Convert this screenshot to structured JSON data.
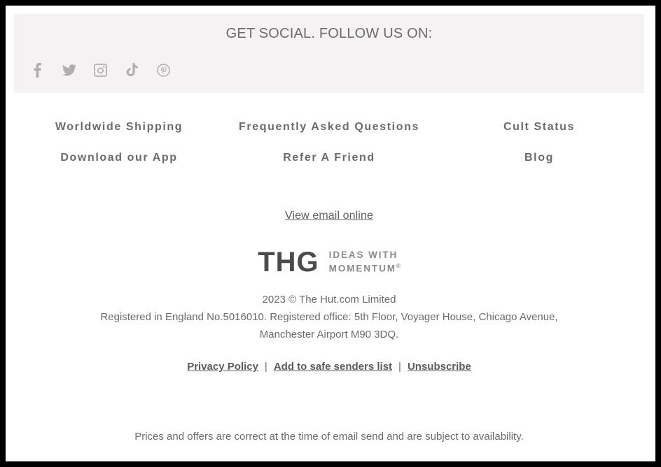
{
  "social": {
    "heading": "GET SOCIAL. FOLLOW US ON:",
    "icons": [
      {
        "name": "facebook-icon",
        "label": "Facebook"
      },
      {
        "name": "twitter-icon",
        "label": "Twitter"
      },
      {
        "name": "instagram-icon",
        "label": "Instagram"
      },
      {
        "name": "tiktok-icon",
        "label": "TikTok"
      },
      {
        "name": "pinterest-icon",
        "label": "Pinterest"
      }
    ],
    "background_color": "#f4f2f2"
  },
  "nav": {
    "rows": [
      [
        {
          "label": "Worldwide Shipping"
        },
        {
          "label": "Frequently Asked Questions"
        },
        {
          "label": "Cult Status"
        }
      ],
      [
        {
          "label": "Download our App"
        },
        {
          "label": "Refer A Friend"
        },
        {
          "label": "Blog"
        }
      ]
    ]
  },
  "view_online": {
    "label": "View email online"
  },
  "logo": {
    "mark": "THG",
    "tagline_line1": "IDEAS WITH",
    "tagline_line2": "MOMENTUM",
    "registered_symbol": "®",
    "mark_color": "#4b4b4b",
    "tagline_color": "#8d8a8a"
  },
  "legal": {
    "lines": [
      "2023 © The Hut.com Limited",
      "Registered in England No.5016010. Registered office: 5th Floor, Voyager House, Chicago Avenue,",
      "Manchester Airport M90 3DQ."
    ],
    "links": [
      {
        "label": "Privacy Policy"
      },
      {
        "label": "Add to safe senders list"
      },
      {
        "label": "Unsubscribe"
      }
    ],
    "separator": "|"
  },
  "disclaimer": {
    "text": "Prices and offers are correct at the time of email send and are subject to availability."
  }
}
